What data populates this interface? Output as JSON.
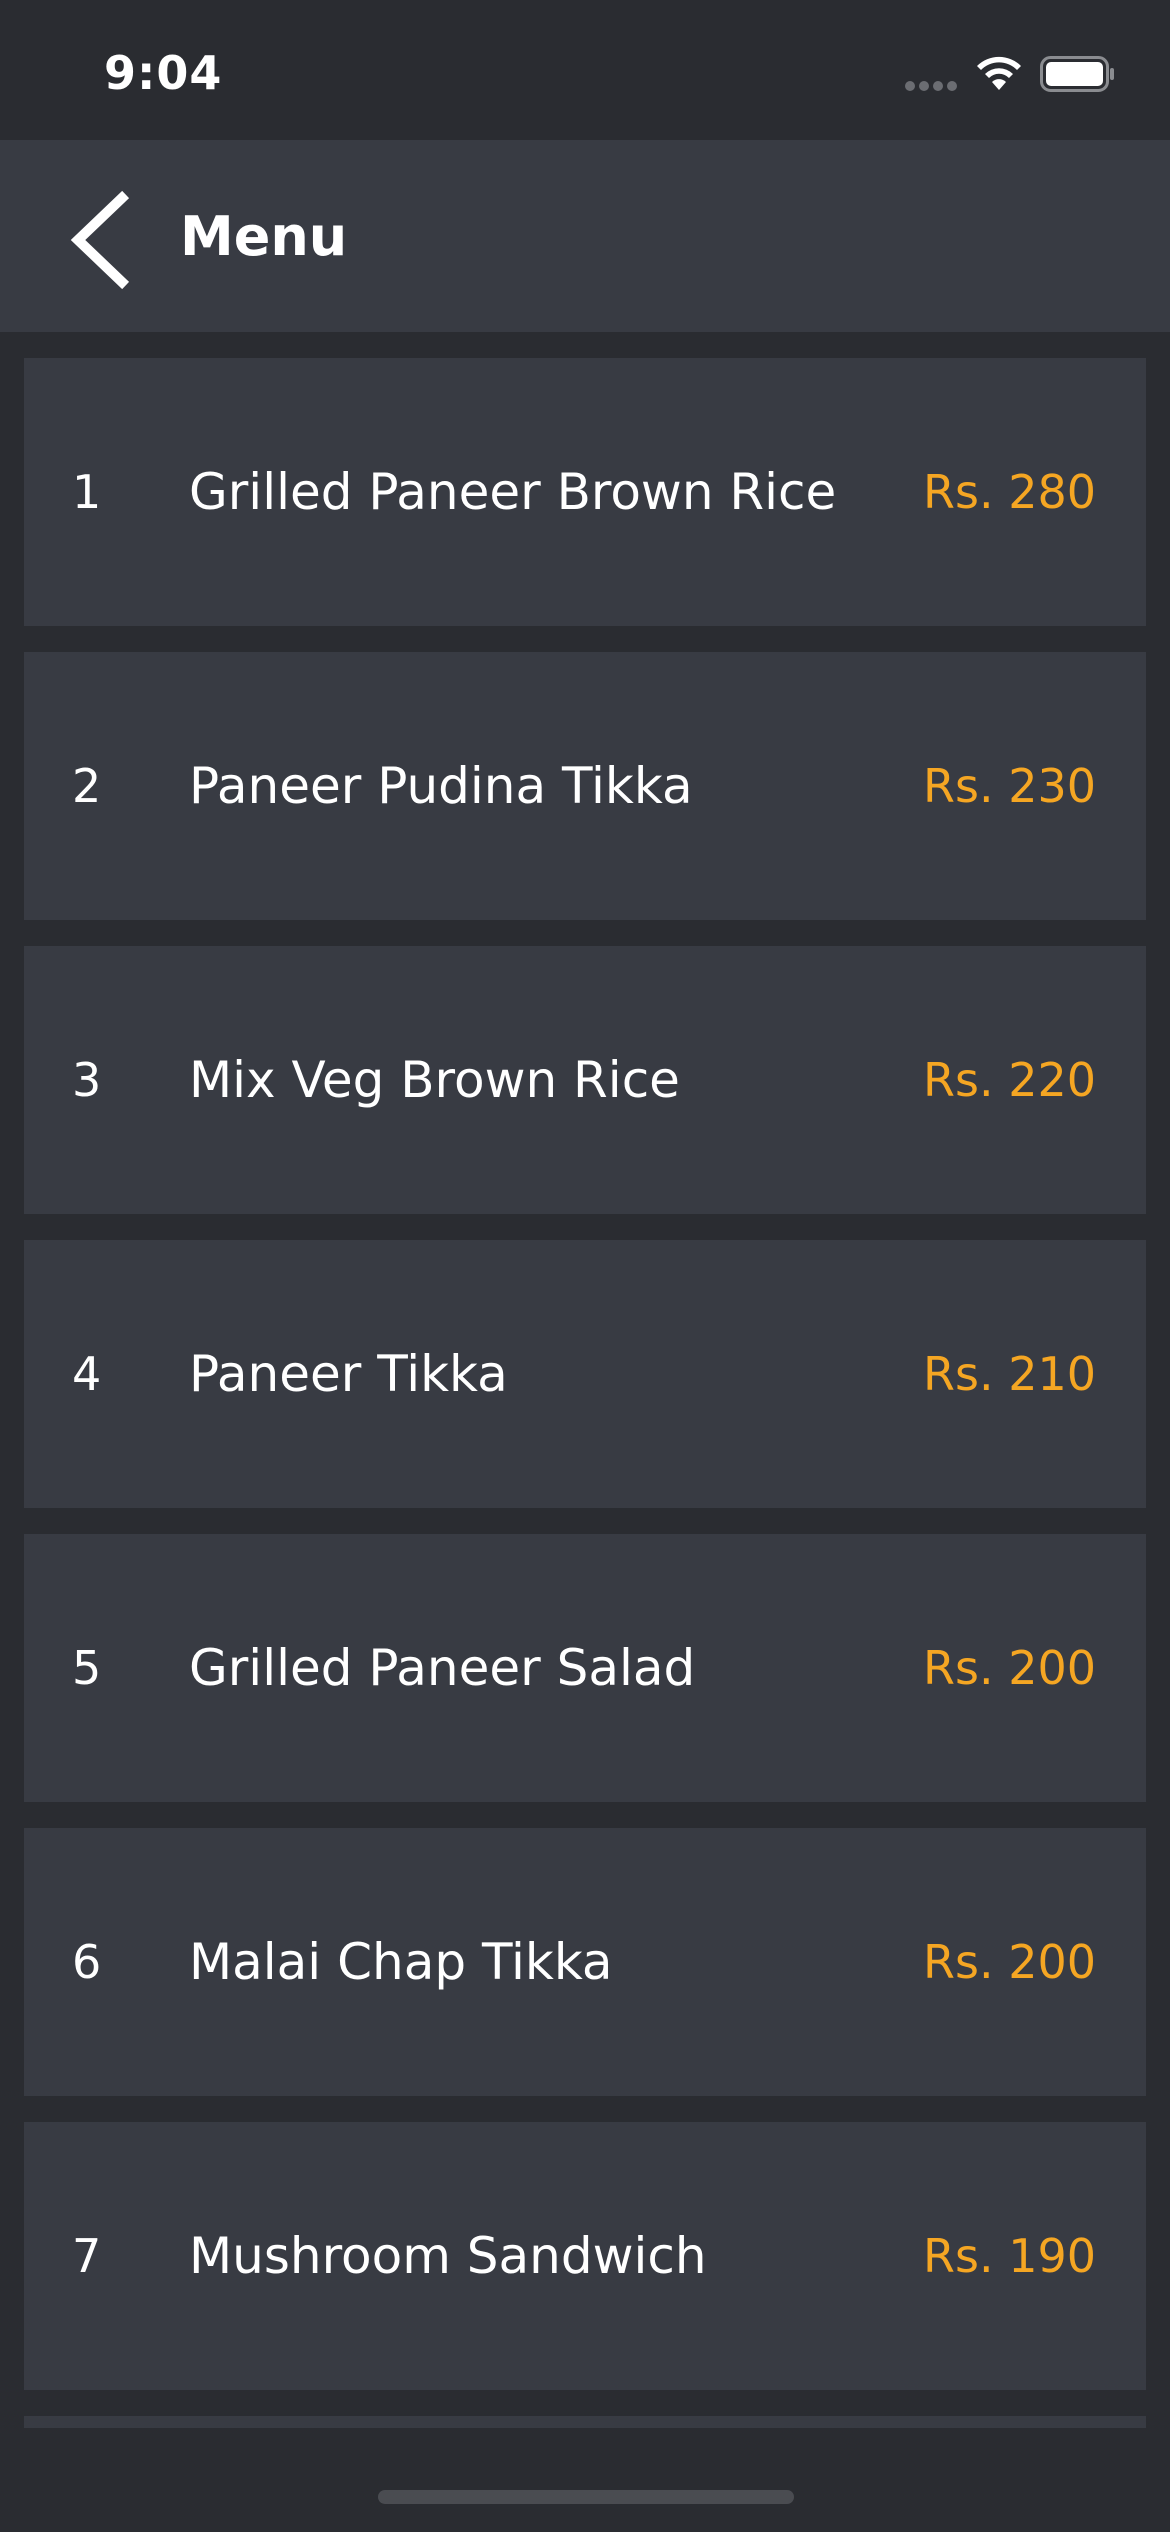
{
  "status_bar": {
    "time": "9:04",
    "icons": [
      "signal-dots-icon",
      "wifi-icon",
      "battery-icon"
    ]
  },
  "nav": {
    "back_icon": "chevron-left-icon",
    "title": "Menu"
  },
  "colors": {
    "background": "#2a2c31",
    "card": "#383b43",
    "price": "#f5a623",
    "text": "#ffffff"
  },
  "menu": {
    "items": [
      {
        "number": "1",
        "name": "Grilled Paneer Brown Rice",
        "price": "Rs. 280"
      },
      {
        "number": "2",
        "name": "Paneer Pudina Tikka",
        "price": "Rs. 230"
      },
      {
        "number": "3",
        "name": "Mix Veg Brown Rice",
        "price": "Rs. 220"
      },
      {
        "number": "4",
        "name": "Paneer Tikka",
        "price": "Rs. 210"
      },
      {
        "number": "5",
        "name": "Grilled Paneer Salad",
        "price": "Rs. 200"
      },
      {
        "number": "6",
        "name": "Malai Chap Tikka",
        "price": "Rs. 200"
      },
      {
        "number": "7",
        "name": "Mushroom Sandwich",
        "price": "Rs. 190"
      }
    ]
  }
}
